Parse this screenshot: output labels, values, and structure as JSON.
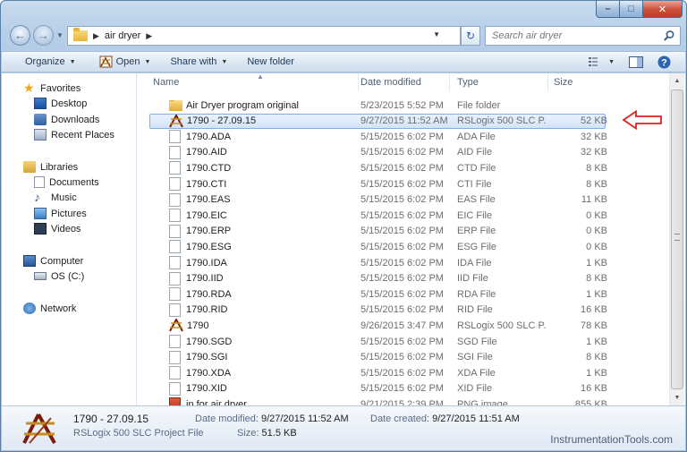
{
  "address": {
    "crumbs": [
      "air dryer"
    ],
    "search_placeholder": "Search air dryer"
  },
  "toolbar": {
    "organize": "Organize",
    "open": "Open",
    "share_with": "Share with",
    "new_folder": "New folder"
  },
  "nav": {
    "favorites": "Favorites",
    "desktop": "Desktop",
    "downloads": "Downloads",
    "recent_places": "Recent Places",
    "libraries": "Libraries",
    "documents": "Documents",
    "music": "Music",
    "pictures": "Pictures",
    "videos": "Videos",
    "computer": "Computer",
    "os_drive": "OS (C:)",
    "network": "Network"
  },
  "columns": {
    "name": "Name",
    "date": "Date modified",
    "type": "Type",
    "size": "Size"
  },
  "files": [
    {
      "name": "Air Dryer program original",
      "date": "5/23/2015 5:52 PM",
      "type": "File folder",
      "size": "",
      "icon": "folder-icon"
    },
    {
      "name": "1790 - 27.09.15",
      "date": "9/27/2015 11:52 AM",
      "type": "RSLogix 500 SLC P...",
      "size": "52 KB",
      "icon": "rslogix-icon",
      "selected": true
    },
    {
      "name": "1790.ADA",
      "date": "5/15/2015 6:02 PM",
      "type": "ADA File",
      "size": "32 KB",
      "icon": "file-icon"
    },
    {
      "name": "1790.AID",
      "date": "5/15/2015 6:02 PM",
      "type": "AID File",
      "size": "32 KB",
      "icon": "file-icon"
    },
    {
      "name": "1790.CTD",
      "date": "5/15/2015 6:02 PM",
      "type": "CTD File",
      "size": "8 KB",
      "icon": "file-icon"
    },
    {
      "name": "1790.CTI",
      "date": "5/15/2015 6:02 PM",
      "type": "CTI File",
      "size": "8 KB",
      "icon": "file-icon"
    },
    {
      "name": "1790.EAS",
      "date": "5/15/2015 6:02 PM",
      "type": "EAS File",
      "size": "11 KB",
      "icon": "file-icon"
    },
    {
      "name": "1790.EIC",
      "date": "5/15/2015 6:02 PM",
      "type": "EIC File",
      "size": "0 KB",
      "icon": "file-icon"
    },
    {
      "name": "1790.ERP",
      "date": "5/15/2015 6:02 PM",
      "type": "ERP File",
      "size": "0 KB",
      "icon": "file-icon"
    },
    {
      "name": "1790.ESG",
      "date": "5/15/2015 6:02 PM",
      "type": "ESG File",
      "size": "0 KB",
      "icon": "file-icon"
    },
    {
      "name": "1790.IDA",
      "date": "5/15/2015 6:02 PM",
      "type": "IDA File",
      "size": "1 KB",
      "icon": "file-icon"
    },
    {
      "name": "1790.IID",
      "date": "5/15/2015 6:02 PM",
      "type": "IID File",
      "size": "8 KB",
      "icon": "file-icon"
    },
    {
      "name": "1790.RDA",
      "date": "5/15/2015 6:02 PM",
      "type": "RDA File",
      "size": "1 KB",
      "icon": "file-icon"
    },
    {
      "name": "1790.RID",
      "date": "5/15/2015 6:02 PM",
      "type": "RID File",
      "size": "16 KB",
      "icon": "file-icon"
    },
    {
      "name": "1790",
      "date": "9/26/2015 3:47 PM",
      "type": "RSLogix 500 SLC P...",
      "size": "78 KB",
      "icon": "rslogix-icon"
    },
    {
      "name": "1790.SGD",
      "date": "5/15/2015 6:02 PM",
      "type": "SGD File",
      "size": "1 KB",
      "icon": "file-icon"
    },
    {
      "name": "1790.SGI",
      "date": "5/15/2015 6:02 PM",
      "type": "SGI File",
      "size": "8 KB",
      "icon": "file-icon"
    },
    {
      "name": "1790.XDA",
      "date": "5/15/2015 6:02 PM",
      "type": "XDA File",
      "size": "1 KB",
      "icon": "file-icon"
    },
    {
      "name": "1790.XID",
      "date": "5/15/2015 6:02 PM",
      "type": "XID File",
      "size": "16 KB",
      "icon": "file-icon"
    },
    {
      "name": "in for air dryer",
      "date": "9/21/2015 2:39 PM",
      "type": "PNG image",
      "size": "855 KB",
      "icon": "png-icon"
    }
  ],
  "details": {
    "name": "1790 - 27.09.15",
    "type": "RSLogix 500 SLC Project File",
    "modified_label": "Date modified:",
    "modified_value": "9/27/2015 11:52 AM",
    "created_label": "Date created:",
    "created_value": "9/27/2015 11:51 AM",
    "size_label": "Size:",
    "size_value": "51.5 KB"
  },
  "watermark": "InstrumentationTools.com",
  "colors": {
    "annotation_arrow": "#e02020",
    "selection_border": "#84acdd"
  }
}
